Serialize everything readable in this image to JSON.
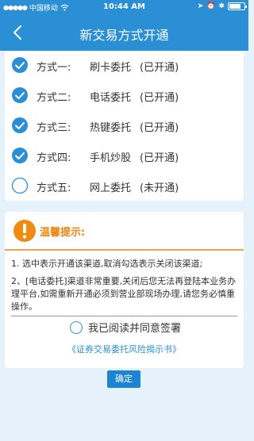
{
  "status_bar": {
    "signal": "●●●●●",
    "carrier": "中国移动",
    "time": "10:44 AM"
  },
  "nav": {
    "title": "新交易方式开通"
  },
  "methods": [
    {
      "name": "方式一:",
      "service": "刷卡委托",
      "status": "(已开通)",
      "checked": true
    },
    {
      "name": "方式二:",
      "service": "电话委托",
      "status": "(已开通)",
      "checked": true
    },
    {
      "name": "方式三:",
      "service": "热键委托",
      "status": "(已开通)",
      "checked": true
    },
    {
      "name": "方式四:",
      "service": "手机炒股",
      "status": "(已开通)",
      "checked": true
    },
    {
      "name": "方式五:",
      "service": "网上委托",
      "status": "(未开通)",
      "checked": false
    }
  ],
  "notice": {
    "title": "温馨提示:",
    "line1": "1. 选中表示开通该渠道,取消勾选表示关闭该渠道;",
    "line2": "2、[电话委托]渠道非常重要,关闭后您无法再登陆本业务办理平台,如需重新开通必须到营业部现场办理,请您务必慎重操作。",
    "agree_label": "我已阅读并同意签署",
    "link": "《证券交易委托风险揭示书》"
  },
  "confirm_label": "确定",
  "colors": {
    "primary": "#2b8fd6",
    "warning": "#e8860f",
    "background": "#e6f2fb"
  }
}
